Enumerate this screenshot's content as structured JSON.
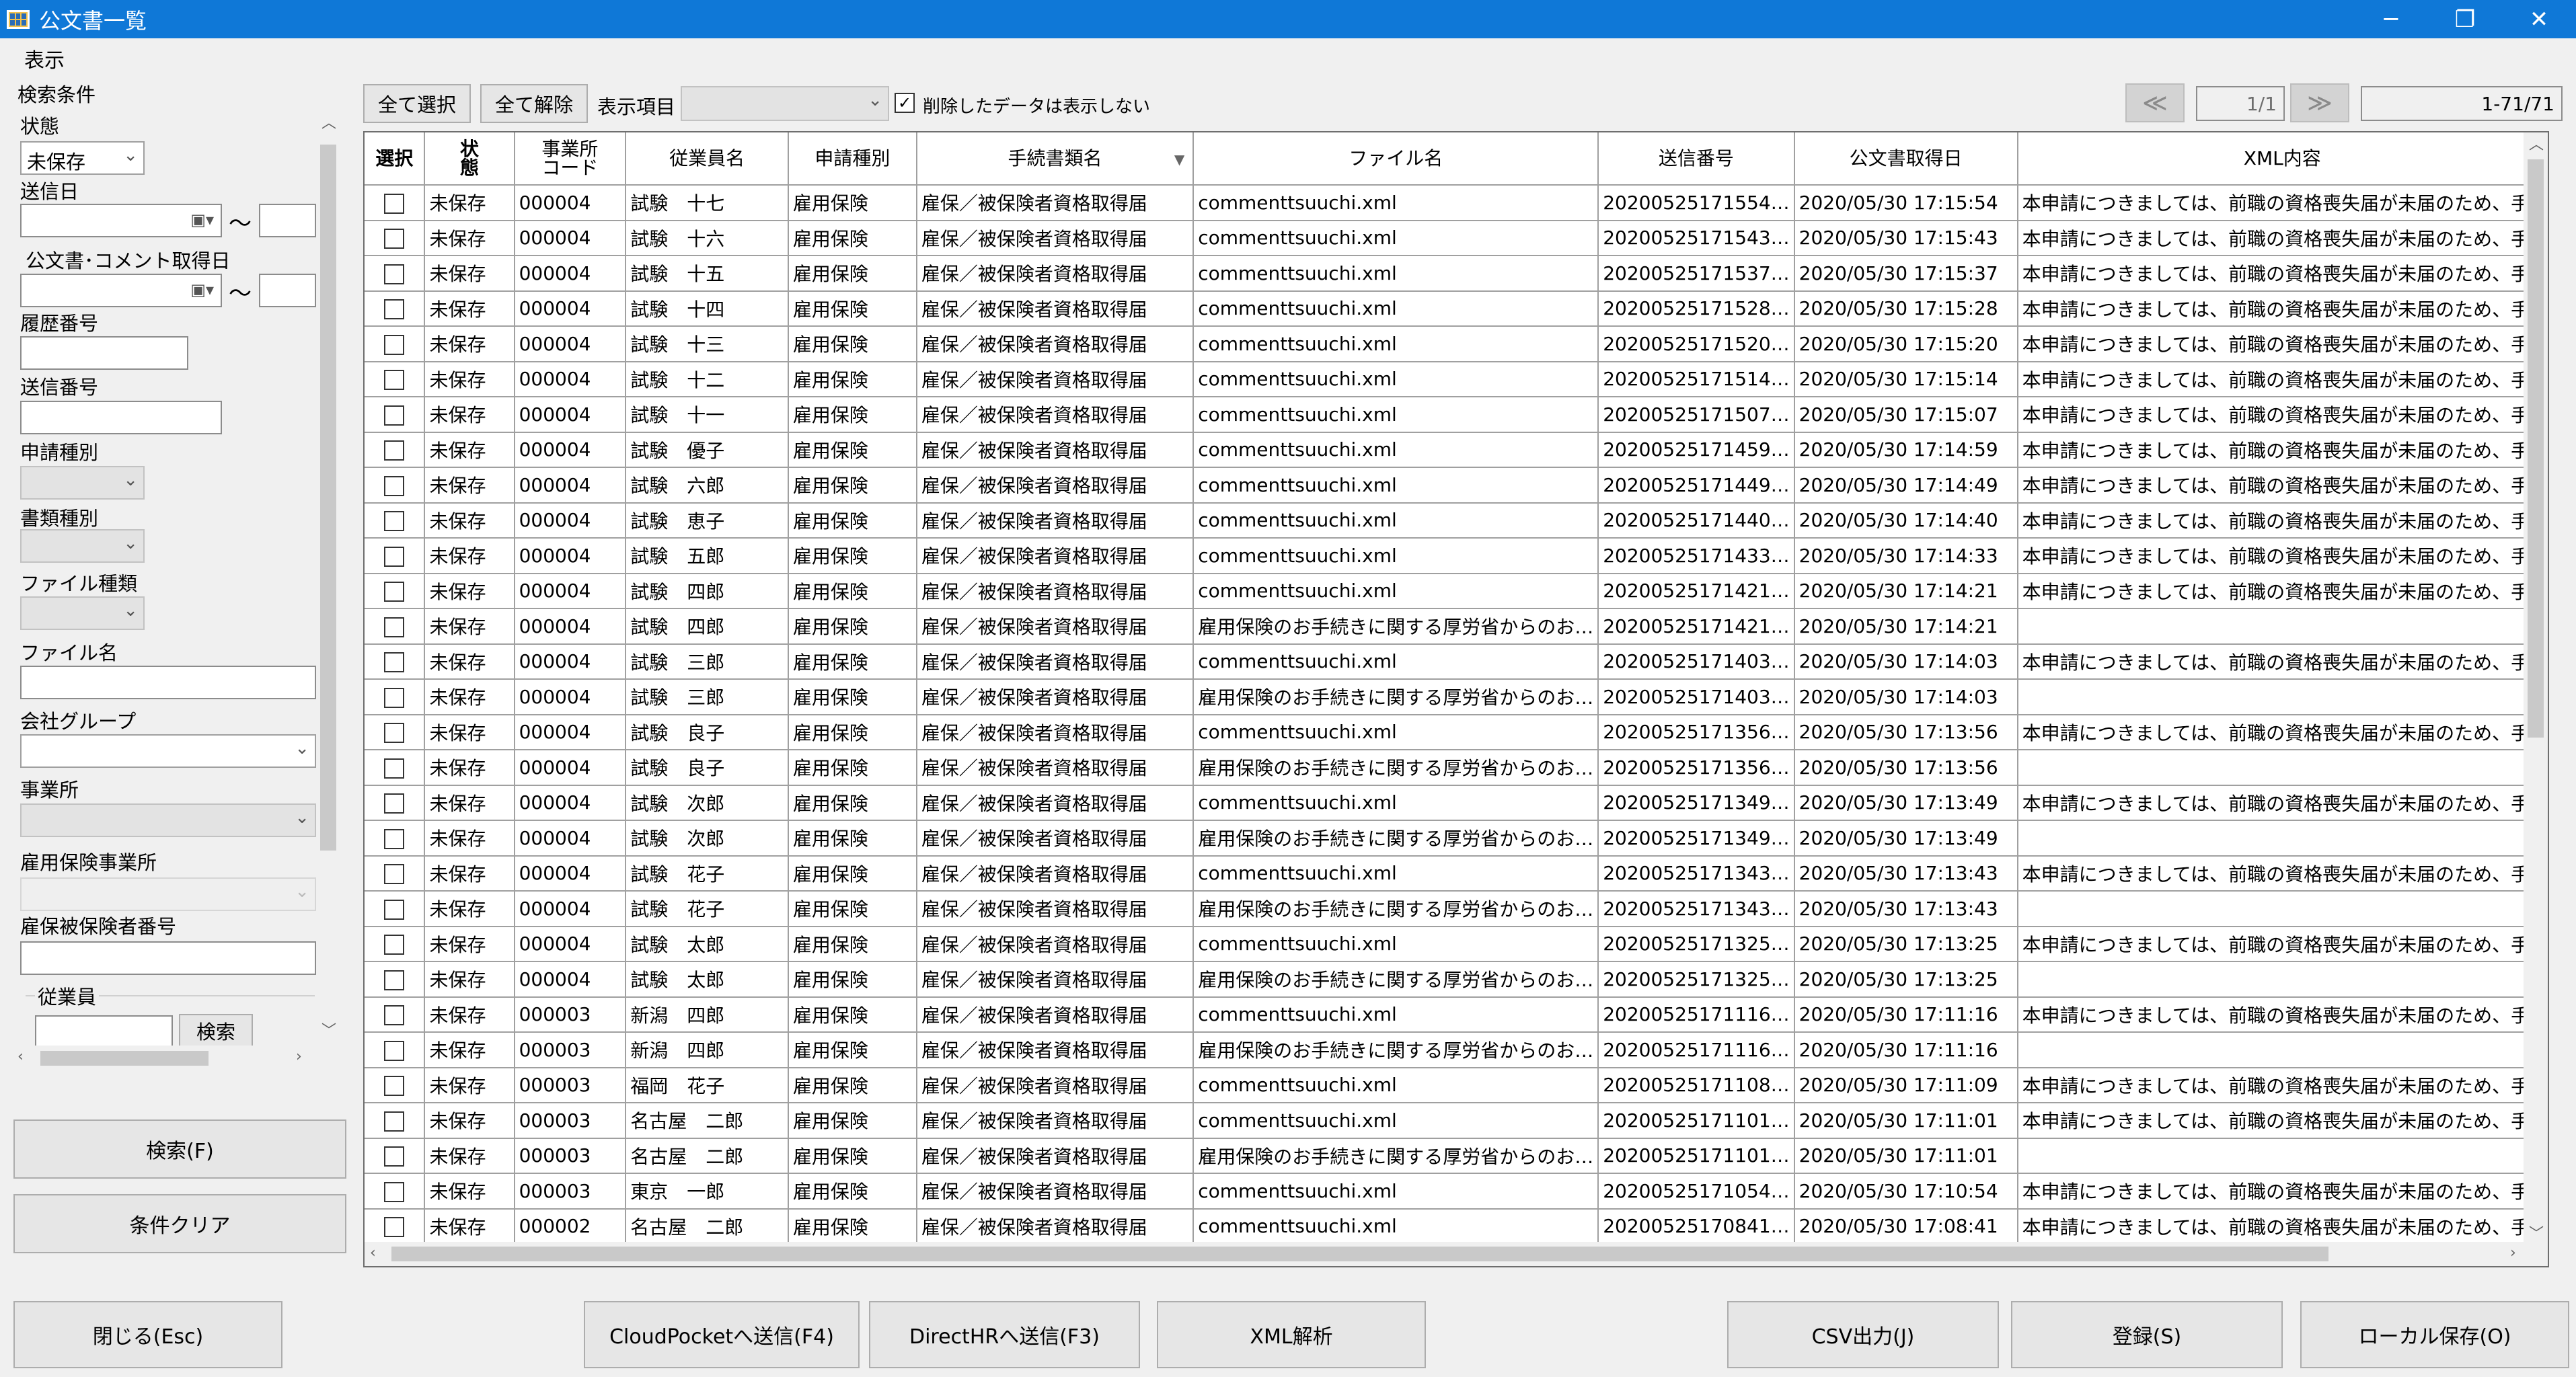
{
  "window": {
    "title": "公文書一覧",
    "minimize": "─",
    "restore": "❐",
    "close": "✕"
  },
  "menu": {
    "view": "表示"
  },
  "left": {
    "group_title": "検索条件",
    "status_label": "状態",
    "status_value": "未保存",
    "send_date_label": "送信日",
    "range_sep": "〜",
    "doc_date_label": "公文書･コメント取得日",
    "history_no_label": "履歴番号",
    "send_no_label": "送信番号",
    "app_type_label": "申請種別",
    "doc_type_label": "書類種別",
    "file_type_label": "ファイル種類",
    "file_name_label": "ファイル名",
    "company_group_label": "会社グループ",
    "office_label": "事業所",
    "ei_office_label": "雇用保険事業所",
    "ei_number_label": "雇保被保険者番号",
    "employee_label": "従業員",
    "employee_search": "検索",
    "search_button": "検索(F)",
    "clear_button": "条件クリア"
  },
  "toolbar": {
    "select_all": "全て選択",
    "deselect_all": "全て解除",
    "display_items_label": "表示項目",
    "hide_deleted_label": "削除したデータは表示しない",
    "hide_deleted_checked": "✓",
    "prev": "≪",
    "next": "≫",
    "page": "1/1",
    "range": "1-71/71"
  },
  "grid": {
    "columns": [
      "選択",
      "状態",
      "事業所コード",
      "従業員名",
      "申請種別",
      "手続書類名",
      "ファイル名",
      "送信番号",
      "公文書取得日",
      "XML内容"
    ],
    "col_select": "選択",
    "col_status": "状\n態",
    "col_office_code": "事業所\nコード",
    "rows": [
      [
        "未保存",
        "000004",
        "試験　十七",
        "雇用保険",
        "雇保／被保険者資格取得届",
        "commenttsuuchi.xml",
        "20200525171554…",
        "2020/05/30 17:15:54",
        "本申請につきましては、前職の資格喪失届が未届のため、手"
      ],
      [
        "未保存",
        "000004",
        "試験　十六",
        "雇用保険",
        "雇保／被保険者資格取得届",
        "commenttsuuchi.xml",
        "20200525171543…",
        "2020/05/30 17:15:43",
        "本申請につきましては、前職の資格喪失届が未届のため、手"
      ],
      [
        "未保存",
        "000004",
        "試験　十五",
        "雇用保険",
        "雇保／被保険者資格取得届",
        "commenttsuuchi.xml",
        "20200525171537…",
        "2020/05/30 17:15:37",
        "本申請につきましては、前職の資格喪失届が未届のため、手"
      ],
      [
        "未保存",
        "000004",
        "試験　十四",
        "雇用保険",
        "雇保／被保険者資格取得届",
        "commenttsuuchi.xml",
        "20200525171528…",
        "2020/05/30 17:15:28",
        "本申請につきましては、前職の資格喪失届が未届のため、手"
      ],
      [
        "未保存",
        "000004",
        "試験　十三",
        "雇用保険",
        "雇保／被保険者資格取得届",
        "commenttsuuchi.xml",
        "20200525171520…",
        "2020/05/30 17:15:20",
        "本申請につきましては、前職の資格喪失届が未届のため、手"
      ],
      [
        "未保存",
        "000004",
        "試験　十二",
        "雇用保険",
        "雇保／被保険者資格取得届",
        "commenttsuuchi.xml",
        "20200525171514…",
        "2020/05/30 17:15:14",
        "本申請につきましては、前職の資格喪失届が未届のため、手"
      ],
      [
        "未保存",
        "000004",
        "試験　十一",
        "雇用保険",
        "雇保／被保険者資格取得届",
        "commenttsuuchi.xml",
        "20200525171507…",
        "2020/05/30 17:15:07",
        "本申請につきましては、前職の資格喪失届が未届のため、手"
      ],
      [
        "未保存",
        "000004",
        "試験　優子",
        "雇用保険",
        "雇保／被保険者資格取得届",
        "commenttsuuchi.xml",
        "20200525171459…",
        "2020/05/30 17:14:59",
        "本申請につきましては、前職の資格喪失届が未届のため、手"
      ],
      [
        "未保存",
        "000004",
        "試験　六郎",
        "雇用保険",
        "雇保／被保険者資格取得届",
        "commenttsuuchi.xml",
        "20200525171449…",
        "2020/05/30 17:14:49",
        "本申請につきましては、前職の資格喪失届が未届のため、手"
      ],
      [
        "未保存",
        "000004",
        "試験　恵子",
        "雇用保険",
        "雇保／被保険者資格取得届",
        "commenttsuuchi.xml",
        "20200525171440…",
        "2020/05/30 17:14:40",
        "本申請につきましては、前職の資格喪失届が未届のため、手"
      ],
      [
        "未保存",
        "000004",
        "試験　五郎",
        "雇用保険",
        "雇保／被保険者資格取得届",
        "commenttsuuchi.xml",
        "20200525171433…",
        "2020/05/30 17:14:33",
        "本申請につきましては、前職の資格喪失届が未届のため、手"
      ],
      [
        "未保存",
        "000004",
        "試験　四郎",
        "雇用保険",
        "雇保／被保険者資格取得届",
        "commenttsuuchi.xml",
        "20200525171421…",
        "2020/05/30 17:14:21",
        "本申請につきましては、前職の資格喪失届が未届のため、手"
      ],
      [
        "未保存",
        "000004",
        "試験　四郎",
        "雇用保険",
        "雇保／被保険者資格取得届",
        "雇用保険のお手続きに関する厚労省からのお…",
        "20200525171421…",
        "2020/05/30 17:14:21",
        ""
      ],
      [
        "未保存",
        "000004",
        "試験　三郎",
        "雇用保険",
        "雇保／被保険者資格取得届",
        "commenttsuuchi.xml",
        "20200525171403…",
        "2020/05/30 17:14:03",
        "本申請につきましては、前職の資格喪失届が未届のため、手"
      ],
      [
        "未保存",
        "000004",
        "試験　三郎",
        "雇用保険",
        "雇保／被保険者資格取得届",
        "雇用保険のお手続きに関する厚労省からのお…",
        "20200525171403…",
        "2020/05/30 17:14:03",
        ""
      ],
      [
        "未保存",
        "000004",
        "試験　良子",
        "雇用保険",
        "雇保／被保険者資格取得届",
        "commenttsuuchi.xml",
        "20200525171356…",
        "2020/05/30 17:13:56",
        "本申請につきましては、前職の資格喪失届が未届のため、手"
      ],
      [
        "未保存",
        "000004",
        "試験　良子",
        "雇用保険",
        "雇保／被保険者資格取得届",
        "雇用保険のお手続きに関する厚労省からのお…",
        "20200525171356…",
        "2020/05/30 17:13:56",
        ""
      ],
      [
        "未保存",
        "000004",
        "試験　次郎",
        "雇用保険",
        "雇保／被保険者資格取得届",
        "commenttsuuchi.xml",
        "20200525171349…",
        "2020/05/30 17:13:49",
        "本申請につきましては、前職の資格喪失届が未届のため、手"
      ],
      [
        "未保存",
        "000004",
        "試験　次郎",
        "雇用保険",
        "雇保／被保険者資格取得届",
        "雇用保険のお手続きに関する厚労省からのお…",
        "20200525171349…",
        "2020/05/30 17:13:49",
        ""
      ],
      [
        "未保存",
        "000004",
        "試験　花子",
        "雇用保険",
        "雇保／被保険者資格取得届",
        "commenttsuuchi.xml",
        "20200525171343…",
        "2020/05/30 17:13:43",
        "本申請につきましては、前職の資格喪失届が未届のため、手"
      ],
      [
        "未保存",
        "000004",
        "試験　花子",
        "雇用保険",
        "雇保／被保険者資格取得届",
        "雇用保険のお手続きに関する厚労省からのお…",
        "20200525171343…",
        "2020/05/30 17:13:43",
        ""
      ],
      [
        "未保存",
        "000004",
        "試験　太郎",
        "雇用保険",
        "雇保／被保険者資格取得届",
        "commenttsuuchi.xml",
        "20200525171325…",
        "2020/05/30 17:13:25",
        "本申請につきましては、前職の資格喪失届が未届のため、手"
      ],
      [
        "未保存",
        "000004",
        "試験　太郎",
        "雇用保険",
        "雇保／被保険者資格取得届",
        "雇用保険のお手続きに関する厚労省からのお…",
        "20200525171325…",
        "2020/05/30 17:13:25",
        ""
      ],
      [
        "未保存",
        "000003",
        "新潟　四郎",
        "雇用保険",
        "雇保／被保険者資格取得届",
        "commenttsuuchi.xml",
        "20200525171116…",
        "2020/05/30 17:11:16",
        "本申請につきましては、前職の資格喪失届が未届のため、手"
      ],
      [
        "未保存",
        "000003",
        "新潟　四郎",
        "雇用保険",
        "雇保／被保険者資格取得届",
        "雇用保険のお手続きに関する厚労省からのお…",
        "20200525171116…",
        "2020/05/30 17:11:16",
        ""
      ],
      [
        "未保存",
        "000003",
        "福岡　花子",
        "雇用保険",
        "雇保／被保険者資格取得届",
        "commenttsuuchi.xml",
        "20200525171108…",
        "2020/05/30 17:11:09",
        "本申請につきましては、前職の資格喪失届が未届のため、手"
      ],
      [
        "未保存",
        "000003",
        "名古屋　二郎",
        "雇用保険",
        "雇保／被保険者資格取得届",
        "commenttsuuchi.xml",
        "20200525171101…",
        "2020/05/30 17:11:01",
        "本申請につきましては、前職の資格喪失届が未届のため、手"
      ],
      [
        "未保存",
        "000003",
        "名古屋　二郎",
        "雇用保険",
        "雇保／被保険者資格取得届",
        "雇用保険のお手続きに関する厚労省からのお…",
        "20200525171101…",
        "2020/05/30 17:11:01",
        ""
      ],
      [
        "未保存",
        "000003",
        "東京　一郎",
        "雇用保険",
        "雇保／被保険者資格取得届",
        "commenttsuuchi.xml",
        "20200525171054…",
        "2020/05/30 17:10:54",
        "本申請につきましては、前職の資格喪失届が未届のため、手"
      ],
      [
        "未保存",
        "000002",
        "名古屋　二郎",
        "雇用保険",
        "雇保／被保険者資格取得届",
        "commenttsuuchi.xml",
        "20200525170841…",
        "2020/05/30 17:08:41",
        "本申請につきましては、前職の資格喪失届が未届のため、手"
      ]
    ]
  },
  "bottom": {
    "close": "閉じる(Esc)",
    "send_cloudpocket": "CloudPocketへ送信(F4)",
    "send_directhr": "DirectHRへ送信(F3)",
    "xml_analyze": "XML解析",
    "csv_output": "CSV出力(J)",
    "register": "登録(S)",
    "local_save": "ローカル保存(O)"
  }
}
